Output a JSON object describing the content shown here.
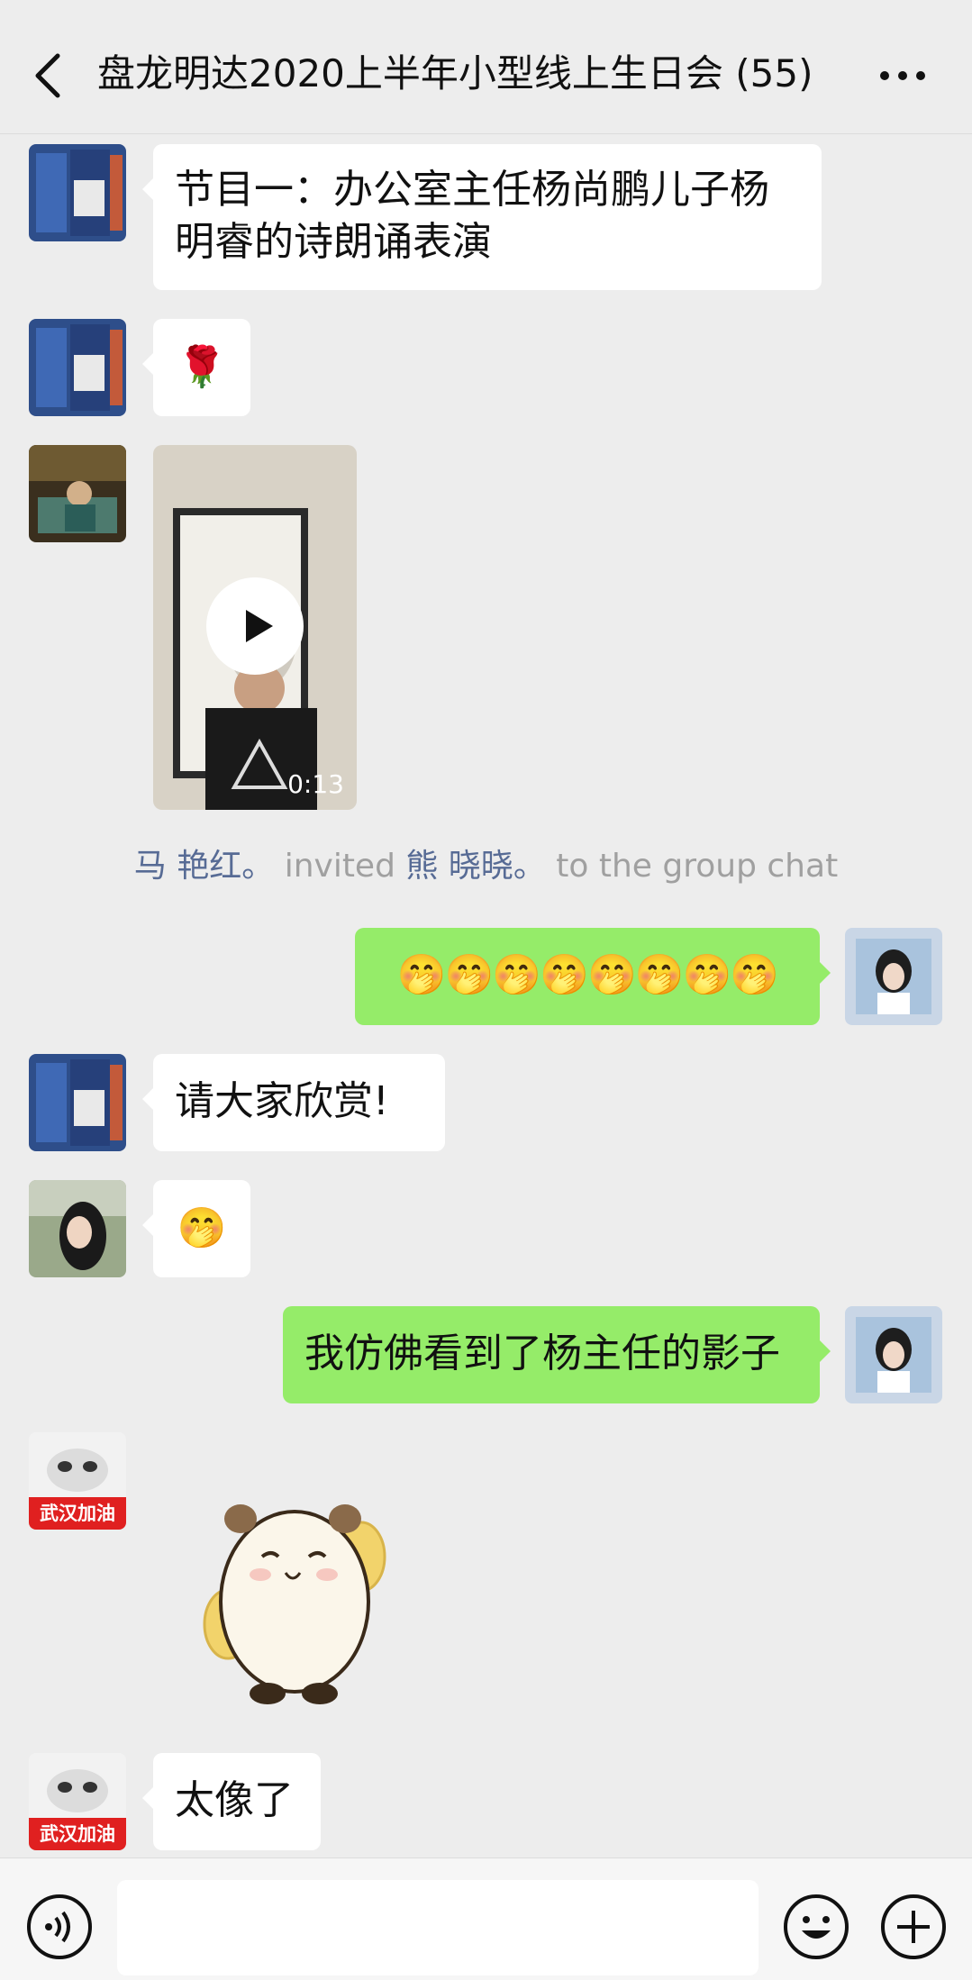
{
  "header": {
    "title": "盘龙明达2020上半年小型线上生日会 (55)",
    "back_icon": "chevron-left-icon",
    "more_icon": "ellipsis-icon"
  },
  "messages": [
    {
      "type": "text",
      "side": "left",
      "text": "节目一：办公室主任杨尚鹏儿子杨明睿的诗朗诵表演"
    },
    {
      "type": "emoji",
      "side": "left",
      "text": "🌹"
    },
    {
      "type": "video",
      "side": "left",
      "duration": "0:13"
    },
    {
      "type": "system",
      "actor": "马 艳红。",
      "verb": " invited ",
      "target": "熊 晓晓。",
      "suffix": " to the group chat"
    },
    {
      "type": "text",
      "side": "right",
      "text": "🤭🤭🤭🤭🤭🤭🤭🤭"
    },
    {
      "type": "text",
      "side": "left",
      "text": "请大家欣赏!"
    },
    {
      "type": "emoji",
      "side": "left",
      "text": "🤭"
    },
    {
      "type": "text",
      "side": "right",
      "text": "我仿佛看到了杨主任的影子"
    },
    {
      "type": "sticker",
      "side": "left",
      "avatar_text": "武汉加油"
    },
    {
      "type": "text",
      "side": "left",
      "text": "太像了",
      "avatar_text": "武汉加油"
    }
  ],
  "bottom_bar": {
    "voice_icon": "voice-icon",
    "emoji_icon": "emoji-icon",
    "plus_icon": "plus-icon",
    "input_value": ""
  },
  "colors": {
    "background": "#ededed",
    "self_bubble": "#95ec69",
    "other_bubble": "#ffffff",
    "link_name": "#576b95"
  }
}
